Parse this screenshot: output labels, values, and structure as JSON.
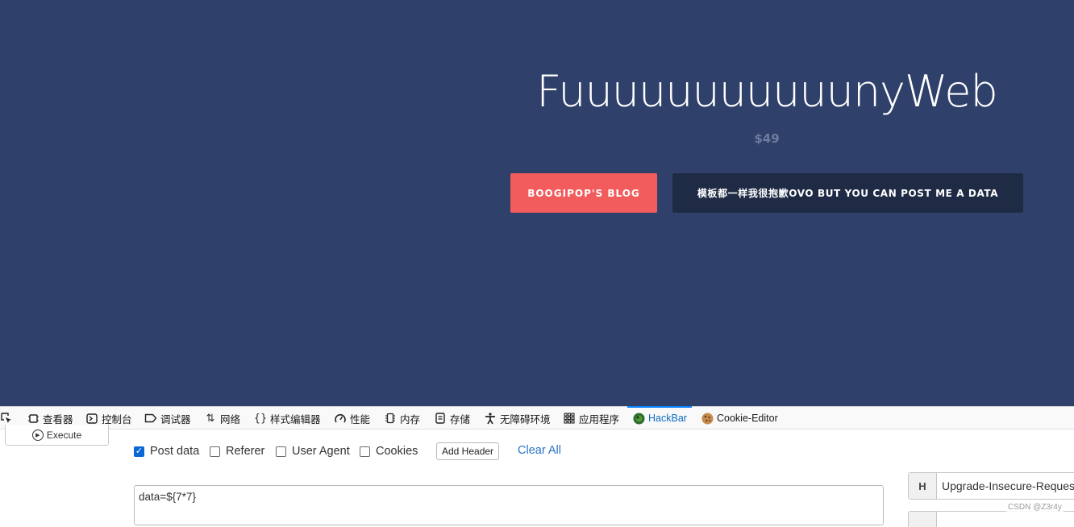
{
  "hero": {
    "title": "FuuuuuuuuuuunyWeb",
    "price": "$49",
    "blog_button": "BOOGIPOP'S BLOG",
    "post_button": "模板都一样我很抱歉OVO BUT YOU CAN POST ME A DATA",
    "colors": {
      "background": "#2f416b",
      "blog_button": "#f25c5c",
      "post_button": "#1f2a45"
    }
  },
  "devtools": {
    "tabs": [
      {
        "label": "查看器",
        "icon": "inspector-icon"
      },
      {
        "label": "控制台",
        "icon": "console-icon"
      },
      {
        "label": "调试器",
        "icon": "debugger-icon"
      },
      {
        "label": "网络",
        "icon": "network-icon"
      },
      {
        "label": "样式编辑器",
        "icon": "style-editor-icon"
      },
      {
        "label": "性能",
        "icon": "performance-icon"
      },
      {
        "label": "内存",
        "icon": "memory-icon"
      },
      {
        "label": "存储",
        "icon": "storage-icon"
      },
      {
        "label": "无障碍环境",
        "icon": "accessibility-icon"
      },
      {
        "label": "应用程序",
        "icon": "application-icon"
      },
      {
        "label": "HackBar",
        "icon": "hackbar-icon",
        "active": true
      },
      {
        "label": "Cookie-Editor",
        "icon": "cookie-icon"
      }
    ]
  },
  "hackbar": {
    "execute_label": "Execute",
    "options": [
      {
        "label": "Post data",
        "checked": true
      },
      {
        "label": "Referer",
        "checked": false
      },
      {
        "label": "User Agent",
        "checked": false
      },
      {
        "label": "Cookies",
        "checked": false
      }
    ],
    "add_header_label": "Add Header",
    "clear_all_label": "Clear All",
    "post_body": "data=${7*7}",
    "header_letter": "H",
    "header_value": "Upgrade-Insecure-Reques"
  },
  "watermark": "CSDN @Z3r4y"
}
